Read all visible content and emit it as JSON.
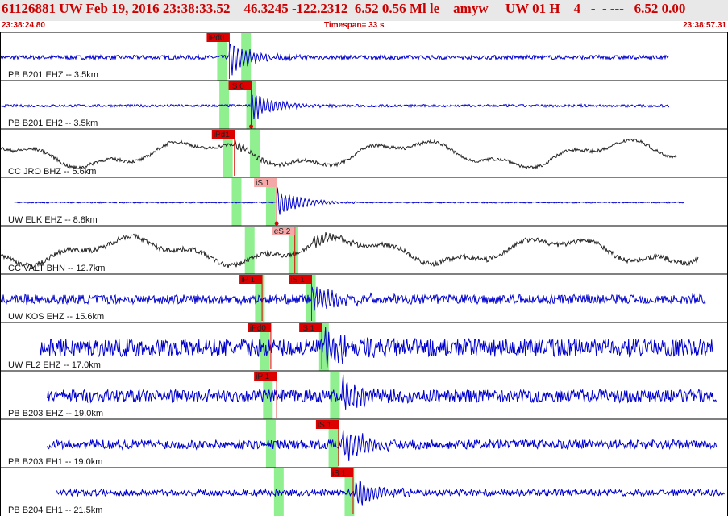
{
  "header": {
    "title": "61126881 UW Feb 19, 2016 23:38:33.52    46.3245 -122.2312  6.52 0.56 Ml le    amyw     UW 01 H    4   -  - ---   6.52 0.00",
    "start_time": "23:38:24.80",
    "timespan": "Timespan=  33 s",
    "end_time": "23:38:57.31"
  },
  "colors": {
    "trace_blue": "#0000cc",
    "trace_black": "#222222",
    "pick_red": "#dd0000",
    "pick_pink": "#f4a8a8",
    "window_green": "#90f090",
    "header_text": "#cc0000"
  },
  "channels": [
    {
      "label": "PB B201 EHZ -- 3.5km",
      "color": "blue",
      "noise": 0.1,
      "start": 0.0,
      "end": 0.92,
      "slow": 0,
      "picks": [
        {
          "label": "iPd0",
          "t": 0.315,
          "style": "red",
          "marker": "line"
        }
      ],
      "greens": [
        0.305,
        0.338
      ],
      "burst": 0.315,
      "burst_amp": 0.9
    },
    {
      "label": "PB B201 EH2 -- 3.5km",
      "color": "blue",
      "noise": 0.06,
      "start": 0.0,
      "end": 0.92,
      "slow": 0,
      "picks": [
        {
          "label": "iS 0",
          "t": 0.345,
          "style": "red",
          "marker": "dot"
        }
      ],
      "greens": [
        0.308,
        0.345
      ],
      "burst": 0.345,
      "burst_amp": 0.8
    },
    {
      "label": "CC JRO BHZ -- 5.6km",
      "color": "black",
      "noise": 0.08,
      "start": 0.0,
      "end": 0.93,
      "slow": 0.55,
      "picks": [
        {
          "label": "iPd1",
          "t": 0.322,
          "style": "red",
          "marker": "line"
        }
      ],
      "greens": [
        0.313,
        0.35
      ],
      "burst": 0.322,
      "burst_amp": 0.3
    },
    {
      "label": "UW ELK EHZ -- 8.8km",
      "color": "blue",
      "noise": 0.03,
      "start": 0.02,
      "end": 0.94,
      "slow": 0,
      "picks": [
        {
          "label": "iS 1",
          "t": 0.38,
          "style": "pink",
          "marker": "dot"
        }
      ],
      "greens": [
        0.325,
        0.372
      ],
      "burst": 0.38,
      "burst_amp": 0.8
    },
    {
      "label": "CC VALT BHN -- 12.7km",
      "color": "black",
      "noise": 0.12,
      "start": 0.0,
      "end": 0.96,
      "slow": 0.55,
      "picks": [
        {
          "label": "eS 2",
          "t": 0.405,
          "style": "pink",
          "marker": "line"
        }
      ],
      "greens": [
        0.343,
        0.403
      ],
      "burst": 0.43,
      "burst_amp": 0.35
    },
    {
      "label": "UW KOS EHZ -- 15.6km",
      "color": "blue",
      "noise": 0.22,
      "start": 0.0,
      "end": 0.97,
      "slow": 0,
      "picks": [
        {
          "label": "iP 1",
          "t": 0.36,
          "style": "red",
          "marker": "line"
        },
        {
          "label": "iS 1",
          "t": 0.428,
          "style": "red",
          "marker": "line"
        }
      ],
      "greens": [
        0.357,
        0.427
      ],
      "burst": 0.428,
      "burst_amp": 0.9
    },
    {
      "label": "UW FL2 EHZ -- 17.0km",
      "color": "blue",
      "noise": 0.42,
      "start": 0.055,
      "end": 0.98,
      "slow": 0,
      "picks": [
        {
          "label": "iPd0",
          "t": 0.372,
          "style": "red",
          "marker": "line"
        },
        {
          "label": "iS 1",
          "t": 0.442,
          "style": "red",
          "marker": "line"
        }
      ],
      "greens": [
        0.364,
        0.445
      ],
      "burst": 0.445,
      "burst_amp": 0.95
    },
    {
      "label": "PB B203 EHZ -- 19.0km",
      "color": "blue",
      "noise": 0.3,
      "start": 0.065,
      "end": 0.985,
      "slow": 0,
      "picks": [
        {
          "label": "iP 1",
          "t": 0.38,
          "style": "red",
          "marker": "line"
        }
      ],
      "greens": [
        0.368,
        0.46
      ],
      "burst": 0.47,
      "burst_amp": 0.95
    },
    {
      "label": "PB B203 EH1 -- 19.0km",
      "color": "blue",
      "noise": 0.22,
      "start": 0.065,
      "end": 0.985,
      "slow": 0,
      "picks": [
        {
          "label": "iS 1",
          "t": 0.465,
          "style": "red",
          "marker": "line"
        }
      ],
      "greens": [
        0.372,
        0.458
      ],
      "burst": 0.47,
      "burst_amp": 0.95
    },
    {
      "label": "PB B204 EH1 -- 21.5km",
      "color": "blue",
      "noise": 0.15,
      "start": 0.078,
      "end": 0.995,
      "slow": 0,
      "picks": [
        {
          "label": "iS 1",
          "t": 0.485,
          "style": "red",
          "marker": "line"
        }
      ],
      "greens": [
        0.383,
        0.48
      ],
      "burst": 0.488,
      "burst_amp": 0.95
    }
  ]
}
